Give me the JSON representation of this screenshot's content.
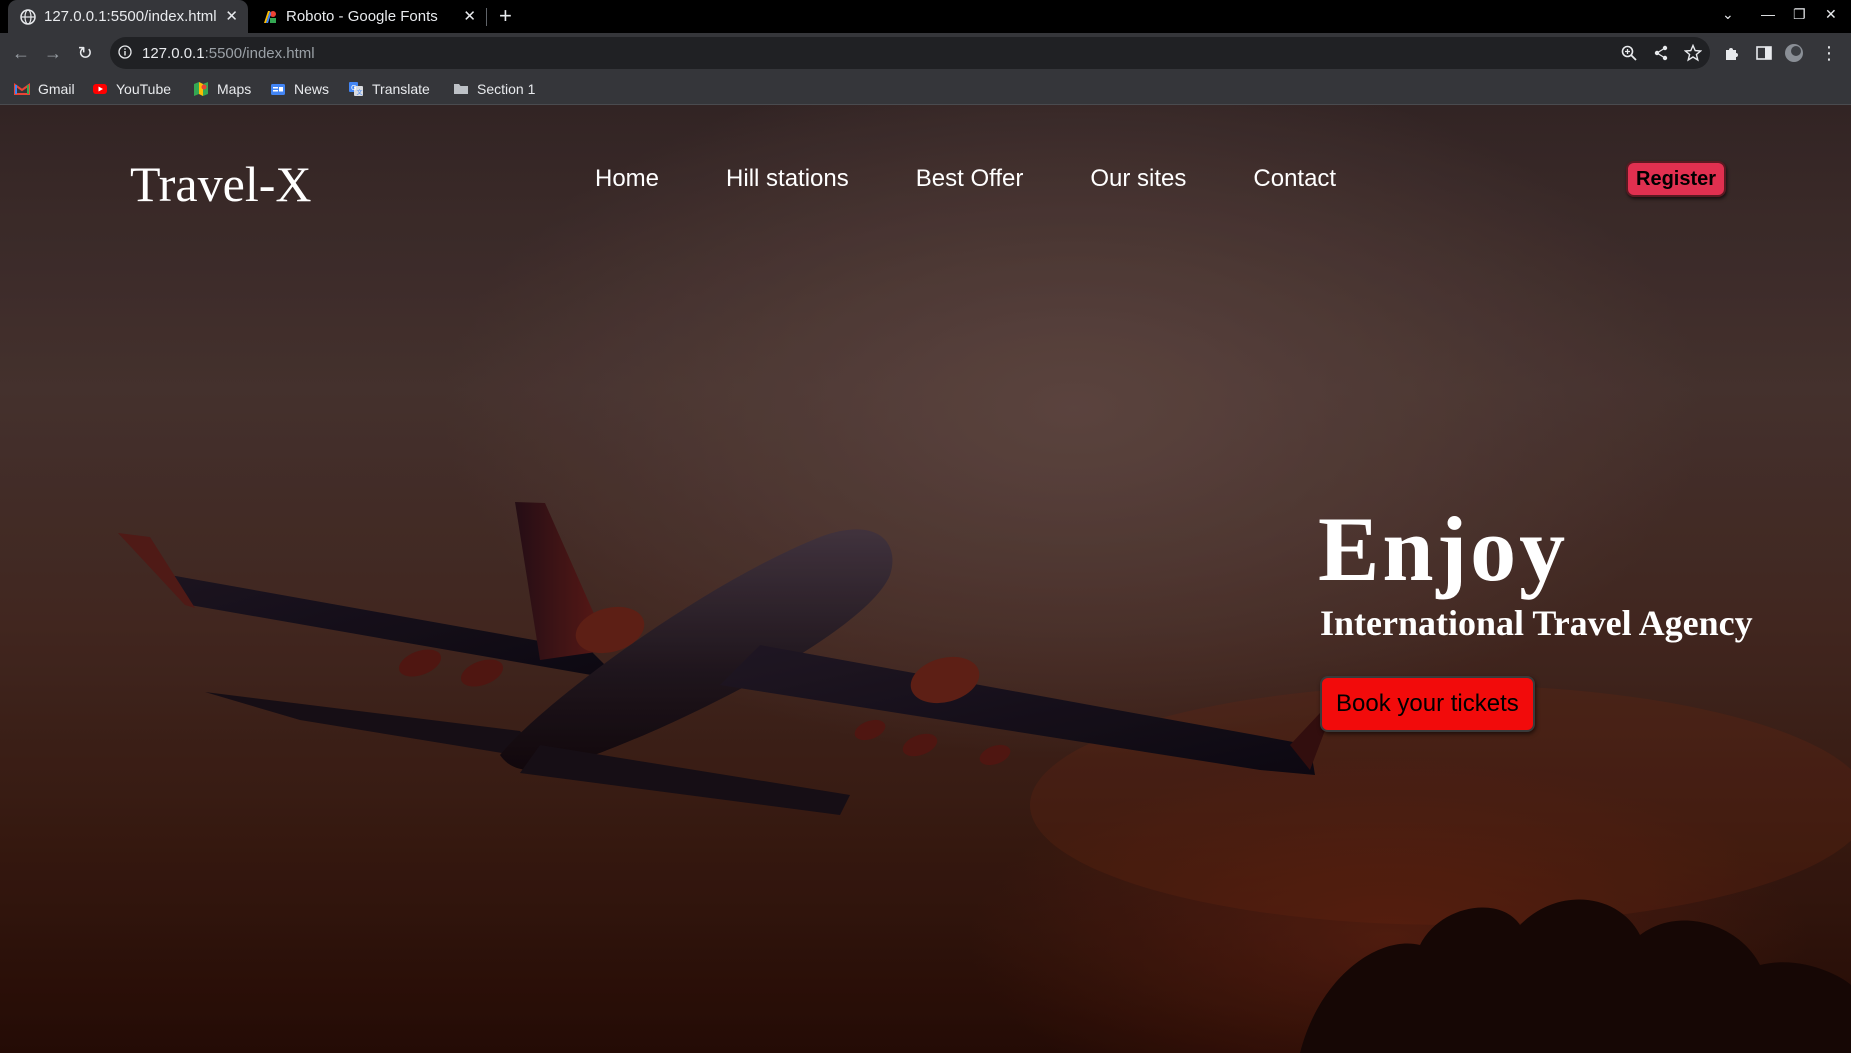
{
  "browser": {
    "tabs": [
      {
        "title": "127.0.0.1:5500/index.html",
        "icon": "globe-icon",
        "active": true
      },
      {
        "title": "Roboto - Google Fonts",
        "icon": "google-fonts-icon",
        "active": false
      }
    ],
    "address_bar": {
      "url_host": "127.0.0.1",
      "url_rest": ":5500/index.html"
    },
    "bookmarks": [
      {
        "label": "Gmail",
        "icon": "gmail-icon"
      },
      {
        "label": "YouTube",
        "icon": "youtube-icon"
      },
      {
        "label": "Maps",
        "icon": "maps-icon"
      },
      {
        "label": "News",
        "icon": "news-icon"
      },
      {
        "label": "Translate",
        "icon": "translate-icon"
      },
      {
        "label": "Section 1",
        "icon": "folder-icon"
      }
    ],
    "colors": {
      "tab_strip": "#000000",
      "toolbar": "#35363a",
      "omnibox": "#202124"
    }
  },
  "page": {
    "logo": "Travel-X",
    "nav": [
      "Home",
      "Hill stations",
      "Best Offer",
      "Our sites",
      "Contact"
    ],
    "register_label": "Register",
    "hero": {
      "title": "Enjoy",
      "subtitle": "International Travel Agency",
      "cta_label": "Book your tickets",
      "background_image": "airplane-at-sunset"
    },
    "colors": {
      "register_bg": "#e03050",
      "cta_bg": "#f20b0b",
      "text": "#ffffff"
    }
  }
}
